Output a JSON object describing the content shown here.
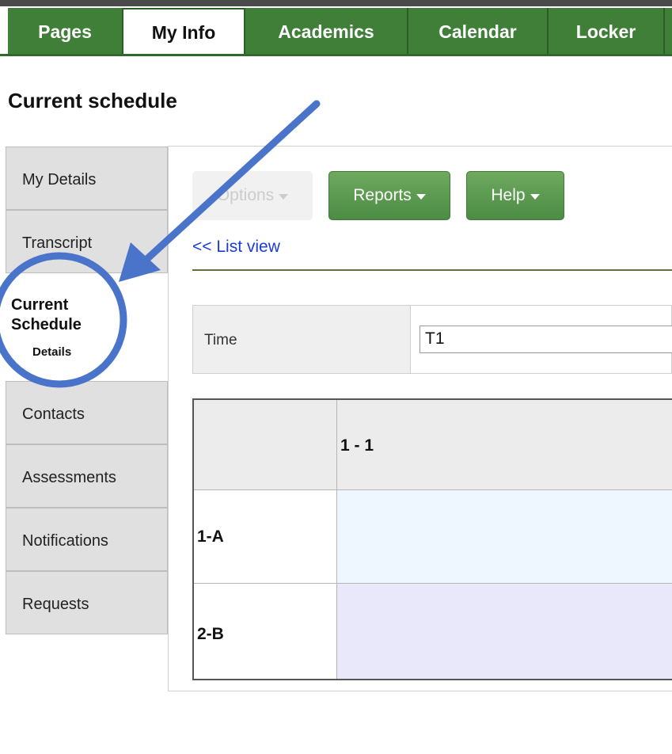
{
  "topnav": {
    "tabs": [
      {
        "label": "Pages"
      },
      {
        "label": "My Info",
        "active": true
      },
      {
        "label": "Academics"
      },
      {
        "label": "Calendar"
      },
      {
        "label": "Locker"
      }
    ]
  },
  "page": {
    "title": "Current schedule"
  },
  "sidebar": {
    "items": [
      {
        "label": "My Details"
      },
      {
        "label": "Transcript"
      },
      {
        "label": "Current Schedule",
        "sublabel": "Details",
        "active": true
      },
      {
        "label": "Contacts"
      },
      {
        "label": "Assessments"
      },
      {
        "label": "Notifications"
      },
      {
        "label": "Requests"
      }
    ]
  },
  "toolbar": {
    "options_label": "Options",
    "reports_label": "Reports",
    "help_label": "Help"
  },
  "list_view_link": "<< List view",
  "time_filter": {
    "label": "Time",
    "value": "T1"
  },
  "schedule_grid": {
    "column_header": "1 - 1",
    "rows": [
      {
        "label": "1-A"
      },
      {
        "label": "2-B"
      }
    ]
  },
  "colors": {
    "nav_green": "#3f7f38",
    "button_green": "#5c9a52",
    "link_blue": "#1a3cd6",
    "annotation_blue": "#4a74c9",
    "row_a_fill": "#eef6ff",
    "row_b_fill": "#e8e8fa"
  }
}
